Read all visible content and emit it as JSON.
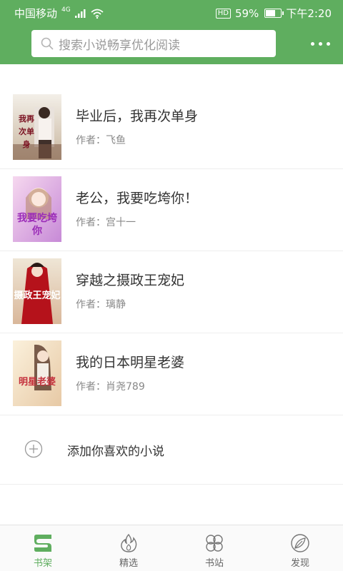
{
  "status_bar": {
    "carrier": "中国移动",
    "network": "4G",
    "hd": "HD",
    "battery": "59%",
    "battery_level": 0.59,
    "time": "下午2:20"
  },
  "search": {
    "placeholder": "搜索小说畅享优化阅读"
  },
  "books": [
    {
      "title": "毕业后，我再次单身",
      "author": "作者：飞鱼",
      "cover_text": "我再次单身"
    },
    {
      "title": "老公，我要吃垮你！",
      "author": "作者：宫十一",
      "cover_text": "我要吃垮你"
    },
    {
      "title": "穿越之摄政王宠妃",
      "author": "作者：璃静",
      "cover_text": "摄政王宠妃"
    },
    {
      "title": "我的日本明星老婆",
      "author": "作者：肖尧789",
      "cover_text": "明星老婆"
    }
  ],
  "add_novel": {
    "label": "添加你喜欢的小说"
  },
  "nav": [
    {
      "label": "书架",
      "icon": "bookshelf-icon",
      "active": true
    },
    {
      "label": "精选",
      "icon": "flame-icon",
      "active": false
    },
    {
      "label": "书站",
      "icon": "clover-icon",
      "active": false
    },
    {
      "label": "发现",
      "icon": "leaf-icon",
      "active": false
    }
  ],
  "colors": {
    "brand_green": "#5fae5f",
    "title_text": "#333333",
    "author_text": "#888888"
  }
}
